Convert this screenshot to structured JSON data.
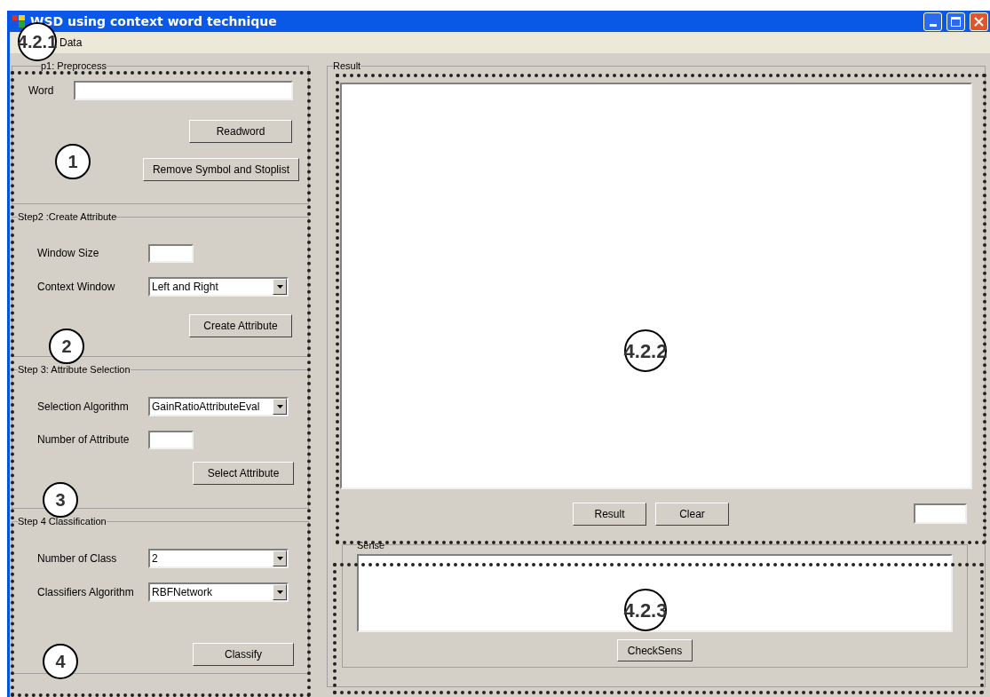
{
  "window": {
    "title": "WSD using context word technique"
  },
  "menu": [
    {
      "label": "Data"
    }
  ],
  "steps": [
    {
      "title": "p1: Preprocess",
      "rows": [
        {
          "kind": "wide_text",
          "label": "Word"
        }
      ],
      "buttons": [
        "Readword",
        "Remove Symbol and Stoplist"
      ]
    },
    {
      "title": "Step2 :Create Attribute",
      "rows": [
        {
          "kind": "short_text",
          "label": "Window Size"
        },
        {
          "kind": "dropdown",
          "label": "Context Window",
          "value": "Left and Right"
        }
      ],
      "buttons": [
        "Create Attribute"
      ]
    },
    {
      "title": "Step 3: Attribute Selection",
      "rows": [
        {
          "kind": "dropdown",
          "label": "Selection Algorithm",
          "value": "GainRatioAttributeEval"
        },
        {
          "kind": "short_text",
          "label": "Number of Attribute"
        }
      ],
      "buttons": [
        "Select Attribute"
      ]
    },
    {
      "title": "Step 4 Classification",
      "rows": [
        {
          "kind": "dropdown",
          "label": "Number of Class",
          "value": "2"
        },
        {
          "kind": "dropdown",
          "label": "Classifiers Algorithm",
          "value": "RBFNetwork"
        }
      ],
      "buttons": [
        "Classify"
      ]
    }
  ],
  "result": {
    "title": "Result",
    "buttons": [
      "Result",
      "Clear"
    ]
  },
  "sense": {
    "title": "Sense",
    "button": "CheckSens"
  },
  "annotations": [
    {
      "label": "4.2.1"
    },
    {
      "label": "1"
    },
    {
      "label": "2"
    },
    {
      "label": "3"
    },
    {
      "label": "4"
    },
    {
      "label": "4.2.2"
    },
    {
      "label": "4.2.3"
    }
  ]
}
